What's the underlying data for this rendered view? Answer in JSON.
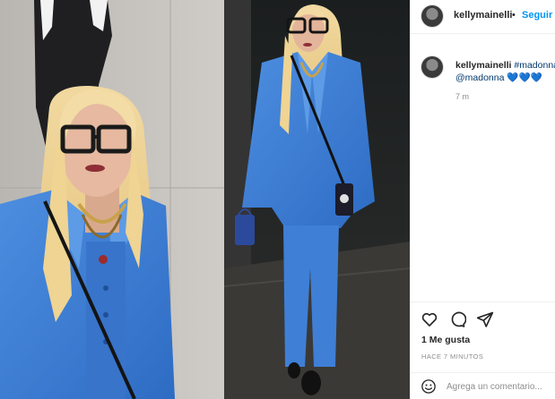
{
  "post": {
    "photo_icon": "photo-of-woman-in-blue-suit",
    "author": "kellymainelli",
    "separator": "•",
    "follow_label": "Seguir"
  },
  "caption": {
    "author": "kellymainelli",
    "text_tag": "#madonna",
    "mention": "@madonna",
    "emoji": "💙💙💙",
    "time": "7 m"
  },
  "actions": {
    "like_icon": "heart-icon",
    "comment_icon": "comment-icon",
    "share_icon": "paper-plane-icon",
    "likes": "1 Me gusta",
    "posted_ago": "HACE 7 MINUTOS"
  },
  "composer": {
    "emoji_icon": "smiley-icon",
    "placeholder": "Agrega un comentario..."
  },
  "colors": {
    "link": "#0095f6",
    "suit_blue": "#3f7fd6",
    "text": "#262626",
    "muted": "#8e8e8e"
  }
}
